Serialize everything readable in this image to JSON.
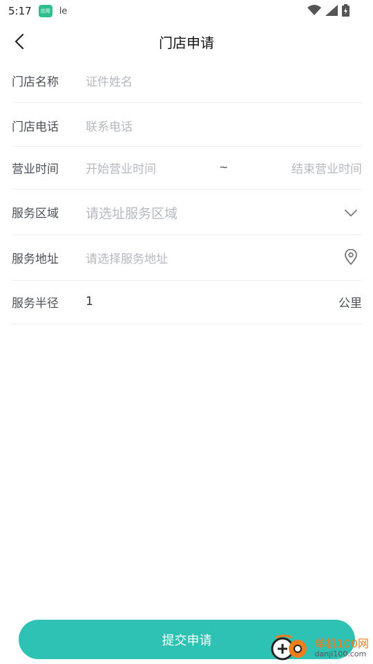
{
  "status_bar": {
    "time": "5:17",
    "app_badge_text": "应用",
    "le_text": "le"
  },
  "header": {
    "title": "门店申请"
  },
  "form": {
    "store_name": {
      "label": "门店名称",
      "placeholder": "证件姓名"
    },
    "store_phone": {
      "label": "门店电话",
      "placeholder": "联系电话"
    },
    "business_hours": {
      "label": "营业时间",
      "start_placeholder": "开始营业时间",
      "separator": "~",
      "end_placeholder": "结束营业时间"
    },
    "service_area": {
      "label": "服务区域",
      "placeholder": "请选址服务区域"
    },
    "service_address": {
      "label": "服务地址",
      "placeholder": "请选择服务地址"
    },
    "service_radius": {
      "label": "服务半径",
      "value": "1",
      "unit": "公里"
    }
  },
  "submit": {
    "label": "提交申请"
  },
  "watermark": {
    "brand": "单机100网",
    "domain": "danji100.com"
  },
  "colors": {
    "accent": "#2ec2b4",
    "placeholder": "#b4b8bf",
    "label": "#4a4f57",
    "divider": "#eeeeee"
  }
}
